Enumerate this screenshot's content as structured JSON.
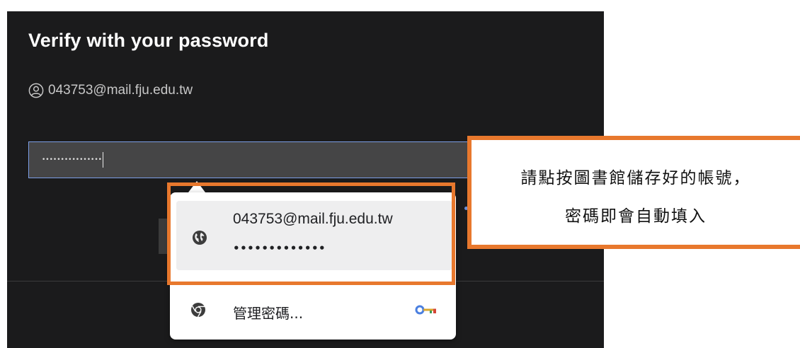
{
  "dialog": {
    "title": "Verify with your password",
    "account_email": "043753@mail.fju.edu.tw",
    "password_masked": "••••••••••••••••",
    "user_icon": "user-circle-icon"
  },
  "autofill_popup": {
    "suggestion": {
      "username": "043753@mail.fju.edu.tw",
      "password_masked": "•••••••••••••",
      "icon": "globe-icon"
    },
    "manage": {
      "label": "管理密碼...",
      "icon": "chrome-icon",
      "key_icon": "key-icon"
    }
  },
  "callout": {
    "line1": "請點按圖書館儲存好的帳號，",
    "line2": "密碼即會自動填入",
    "accent_color": "#e8782d"
  }
}
